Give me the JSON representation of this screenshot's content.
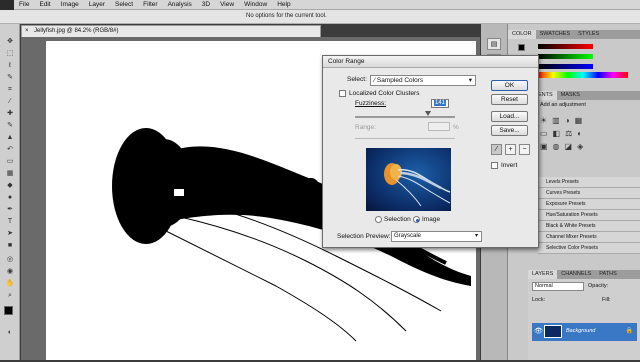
{
  "menu": [
    "File",
    "Edit",
    "Image",
    "Layer",
    "Select",
    "Filter",
    "Analysis",
    "3D",
    "View",
    "Window",
    "Help"
  ],
  "options_bar": {
    "tip": "No options for the current tool."
  },
  "document": {
    "tab_title": "Jellyfish.jpg @ 84.2% (RGB/8#)",
    "close": "×"
  },
  "color_panel": {
    "tabs": [
      "COLOR",
      "SWATCHES",
      "STYLES"
    ]
  },
  "adjustments_panel": {
    "tabs": [
      "ADJUSTMENTS",
      "MASKS"
    ],
    "heading": "Add an adjustment",
    "presets": [
      "Levels Presets",
      "Curves Presets",
      "Exposure Presets",
      "Hue/Saturation Presets",
      "Black & White Presets",
      "Channel Mixer Presets",
      "Selective Color Presets"
    ]
  },
  "layers_panel": {
    "tabs": [
      "LAYERS",
      "CHANNELS",
      "PATHS"
    ],
    "blend_mode": "Normal",
    "opacity_label": "Opacity:",
    "lock_label": "Lock:",
    "fill_label": "Fill:",
    "layer_name": "Background"
  },
  "dialog": {
    "title": "Color Range",
    "select_label": "Select:",
    "select_value": "Sampled Colors",
    "localized_label": "Localized Color Clusters",
    "fuzziness_label": "Fuzziness:",
    "fuzziness_value": "141",
    "range_label": "Range:",
    "range_unit": "%",
    "selection_radio": "Selection",
    "image_radio": "Image",
    "preview_label": "Selection Preview:",
    "preview_value": "Grayscale",
    "buttons": {
      "ok": "OK",
      "reset": "Reset",
      "load": "Load...",
      "save": "Save..."
    },
    "invert_label": "Invert",
    "image_radio_selected": true
  },
  "colors": {
    "accent": "#3a78c6",
    "foreground_swatch": "#000000",
    "background_swatch": "#ffffff"
  }
}
